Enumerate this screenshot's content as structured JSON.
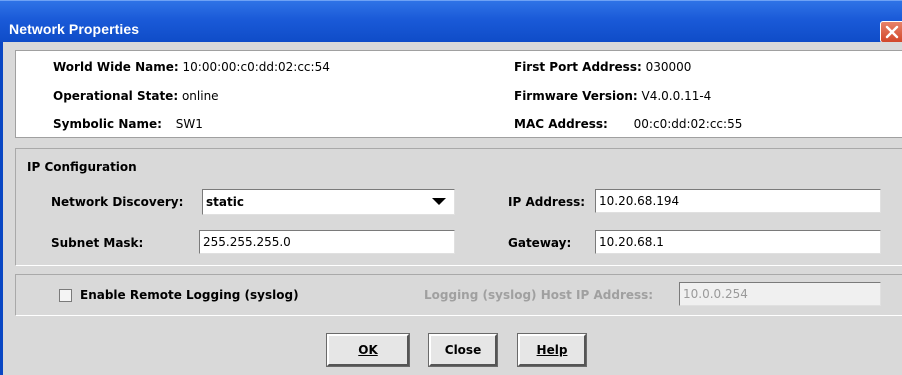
{
  "window": {
    "title": "Network Properties"
  },
  "info": {
    "wwn_label": "World Wide Name:",
    "wwn_value": "10:00:00:c0:dd:02:cc:54",
    "state_label": "Operational State:",
    "state_value": "online",
    "symbolic_label": "Symbolic Name:",
    "symbolic_value": "SW1",
    "port_label": "First Port Address:",
    "port_value": "030000",
    "firmware_label": "Firmware Version:",
    "firmware_value": "V4.0.0.11-4",
    "mac_label": "MAC Address:",
    "mac_value": "00:c0:dd:02:cc:55"
  },
  "ip": {
    "section_title": "IP Configuration",
    "discovery_label": "Network Discovery:",
    "discovery_value": "static",
    "subnet_label": "Subnet Mask:",
    "subnet_value": "255.255.255.0",
    "ip_label": "IP Address:",
    "ip_value": "10.20.68.194",
    "gateway_label": "Gateway:",
    "gateway_value": "10.20.68.1"
  },
  "logging": {
    "enable_label": "Enable Remote Logging (syslog)",
    "enabled": false,
    "host_label": "Logging (syslog) Host IP Address:",
    "host_value": "10.0.0.254"
  },
  "buttons": {
    "ok_label": "OK",
    "close_label": "Close",
    "help_label": "Help"
  },
  "colors": {
    "titlebar": "#1a5ad8",
    "close_button": "#d2472a",
    "dialog_background": "#d9d9d9"
  }
}
